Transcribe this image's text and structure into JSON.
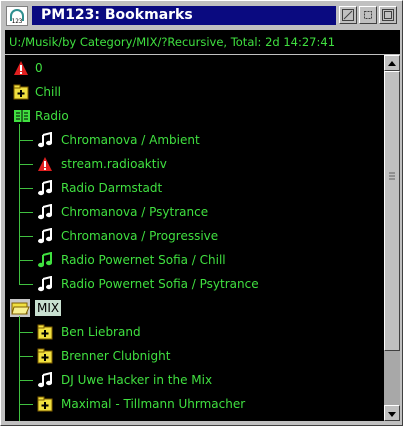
{
  "window": {
    "title": "PM123: Bookmarks",
    "app_icon_label": "123"
  },
  "pathbar": {
    "text": "U:/Musik/by Category/MIX/?Recursive, Total: 2d 14:27:41"
  },
  "tree": {
    "items": [
      {
        "label": "0",
        "icon": "warning-icon",
        "level": 0
      },
      {
        "label": "Chill",
        "icon": "folder-plus-icon",
        "level": 0
      },
      {
        "label": "Radio",
        "icon": "open-book-icon",
        "level": 0
      },
      {
        "label": "Chromanova / Ambient",
        "icon": "music-note-icon",
        "level": 1
      },
      {
        "label": "stream.radioaktiv",
        "icon": "warning-icon",
        "level": 1
      },
      {
        "label": "Radio Darmstadt",
        "icon": "music-note-icon",
        "level": 1
      },
      {
        "label": "Chromanova / Psytrance",
        "icon": "music-note-icon",
        "level": 1
      },
      {
        "label": "Chromanova / Progressive",
        "icon": "music-note-icon",
        "level": 1
      },
      {
        "label": "Radio Powernet Sofia / Chill",
        "icon": "music-note-green-icon",
        "level": 1
      },
      {
        "label": "Radio Powernet Sofia / Psytrance",
        "icon": "music-note-icon",
        "level": 1
      },
      {
        "label": "MIX",
        "icon": "open-folder-icon",
        "level": 0,
        "selected": true
      },
      {
        "label": "Ben Liebrand",
        "icon": "folder-plus-icon",
        "level": 1
      },
      {
        "label": "Brenner Clubnight",
        "icon": "folder-plus-icon",
        "level": 1
      },
      {
        "label": "DJ Uwe Hacker in the Mix",
        "icon": "music-note-icon",
        "level": 1
      },
      {
        "label": "Maximal - Tillmann Uhrmacher",
        "icon": "folder-plus-icon",
        "level": 1
      }
    ]
  },
  "colors": {
    "tree_text": "#40e040",
    "title_bg": "#0a0a80",
    "selection_bg": "#c8e0d0",
    "warning": "#e02020",
    "folder": "#f0e040",
    "book": "#40e040"
  }
}
